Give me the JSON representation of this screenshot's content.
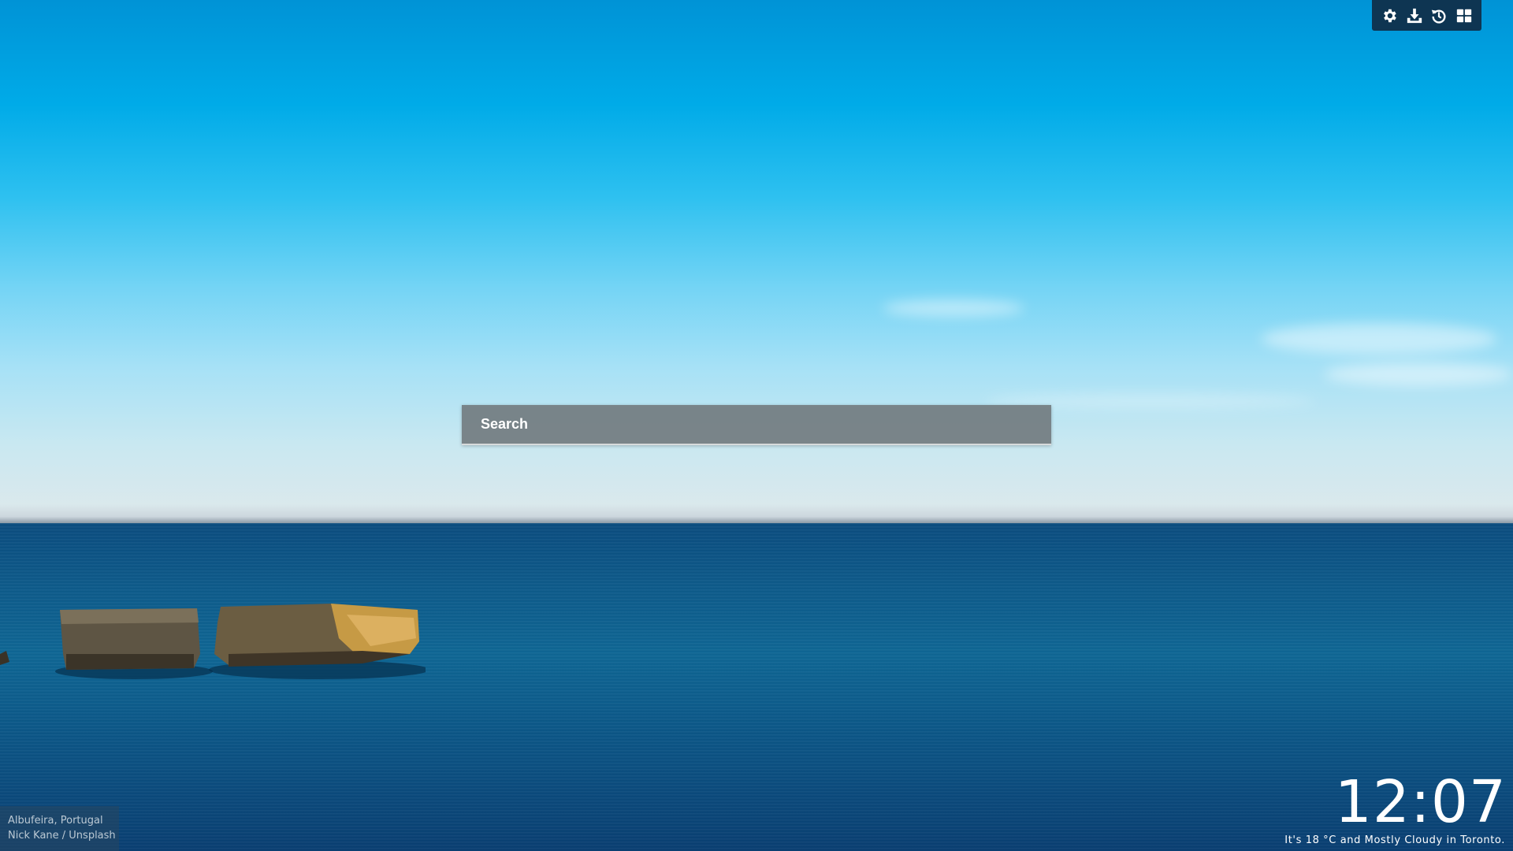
{
  "toolbar": {
    "icons": [
      "gear-icon",
      "download-icon",
      "history-icon",
      "grid-icon"
    ],
    "background": "#0f2d46"
  },
  "search": {
    "placeholder": "Search"
  },
  "photo_credit": {
    "location": "Albufeira, Portugal",
    "author": "Nick Kane / Unsplash"
  },
  "clock": {
    "time": "12:07",
    "weather": "It's 18 °C and Mostly Cloudy in Toronto."
  },
  "colors": {
    "sky_top": "#0093d6",
    "sea": "#0e5a8a"
  }
}
